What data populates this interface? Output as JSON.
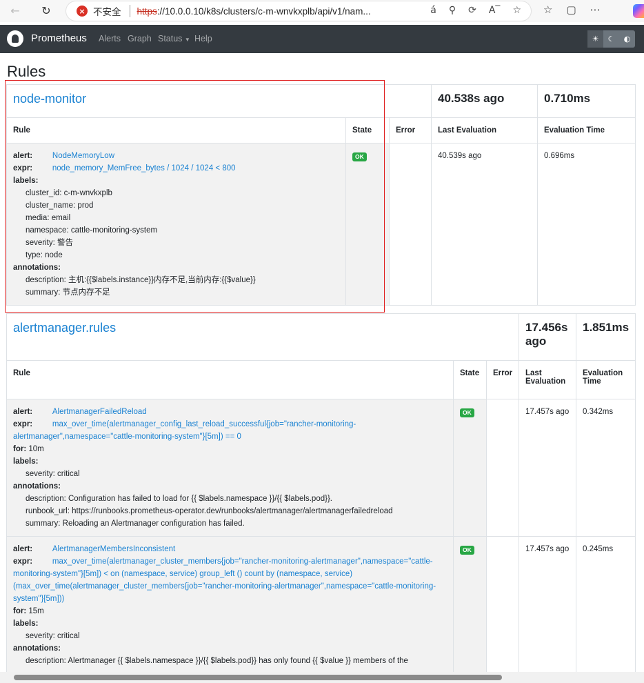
{
  "browser": {
    "security_label": "不安全",
    "url_scheme": "https",
    "url_rest": "://10.0.0.10/k8s/clusters/c-m-wnvkxplb/api/v1/nam...",
    "address_icons": [
      "read-aloud-icon",
      "zoom-icon",
      "translate-icon",
      "font-icon",
      "star-icon"
    ],
    "toolbar_icons": [
      "favorites-icon",
      "collections-icon",
      "more-icon"
    ]
  },
  "nav": {
    "brand": "Prometheus",
    "alerts": "Alerts",
    "graph": "Graph",
    "status": "Status",
    "help": "Help",
    "theme_light": "☀",
    "theme_dark": "☾",
    "theme_auto": "◐"
  },
  "page": {
    "title": "Rules"
  },
  "columns": {
    "rule": "Rule",
    "state": "State",
    "error": "Error",
    "last_eval": "Last Evaluation",
    "eval_time": "Evaluation Time"
  },
  "groups": [
    {
      "name": "node-monitor",
      "last_eval": "40.538s ago",
      "eval_time": "0.710ms",
      "rules": [
        {
          "alert": "NodeMemoryLow",
          "expr": "node_memory_MemFree_bytes / 1024 / 1024 < 800",
          "labels": [
            "cluster_id: c-m-wnvkxplb",
            "cluster_name: prod",
            "media: email",
            "namespace: cattle-monitoring-system",
            "severity: 警告",
            "type: node"
          ],
          "annotations": [
            "description: 主机:{{$labels.instance}}内存不足,当前内存:{{$value}}",
            "summary: 节点内存不足"
          ],
          "state": "OK",
          "last_eval": "40.539s ago",
          "eval_time": "0.696ms"
        }
      ]
    },
    {
      "name": "alertmanager.rules",
      "last_eval": "17.456s ago",
      "eval_time": "1.851ms",
      "rules": [
        {
          "alert": "AlertmanagerFailedReload",
          "expr": "max_over_time(alertmanager_config_last_reload_successful{job=\"rancher-monitoring-alertmanager\",namespace=\"cattle-monitoring-system\"}[5m]) == 0",
          "for": "10m",
          "labels": [
            "severity: critical"
          ],
          "annotations": [
            "description: Configuration has failed to load for {{ $labels.namespace }}/{{ $labels.pod}}.",
            "runbook_url: https://runbooks.prometheus-operator.dev/runbooks/alertmanager/alertmanagerfailedreload",
            "summary: Reloading an Alertmanager configuration has failed."
          ],
          "state": "OK",
          "last_eval": "17.457s ago",
          "eval_time": "0.342ms"
        },
        {
          "alert": "AlertmanagerMembersInconsistent",
          "expr": "max_over_time(alertmanager_cluster_members{job=\"rancher-monitoring-alertmanager\",namespace=\"cattle-monitoring-system\"}[5m]) < on (namespace, service) group_left () count by (namespace, service) (max_over_time(alertmanager_cluster_members{job=\"rancher-monitoring-alertmanager\",namespace=\"cattle-monitoring-system\"}[5m]))",
          "for": "15m",
          "labels": [
            "severity: critical"
          ],
          "annotations": [
            "description: Alertmanager {{ $labels.namespace }}/{{ $labels.pod}} has only found {{ $value }} members of the"
          ],
          "state": "OK",
          "last_eval": "17.457s ago",
          "eval_time": "0.245ms"
        }
      ]
    }
  ],
  "keys": {
    "alert": "alert:",
    "expr": "expr:",
    "for": "for:",
    "labels": "labels:",
    "annotations": "annotations:"
  }
}
